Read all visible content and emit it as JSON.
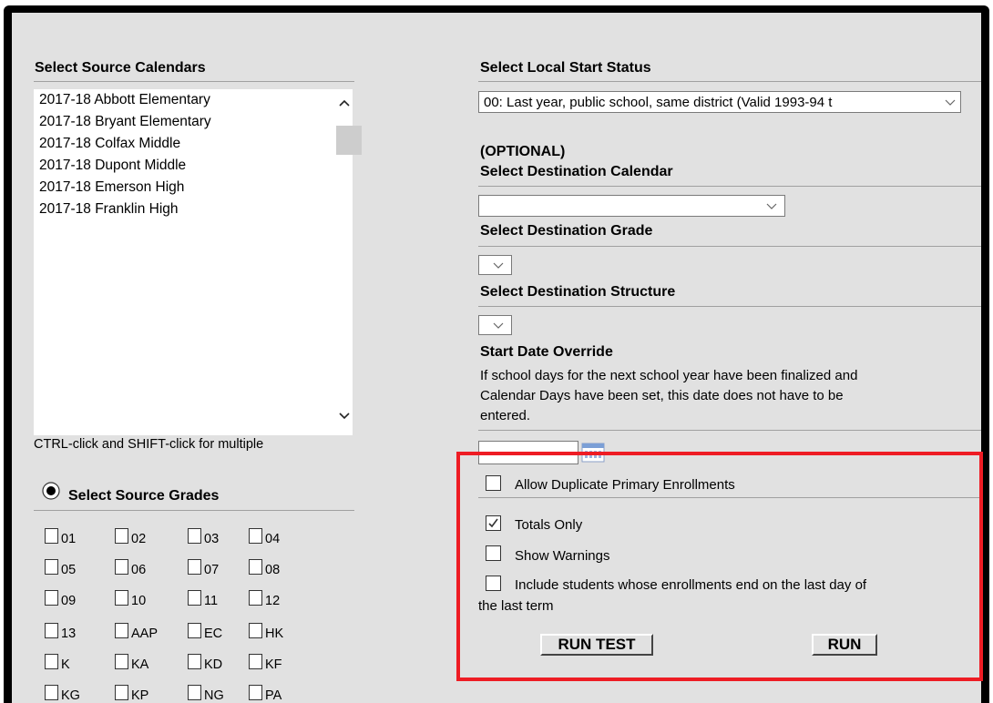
{
  "left": {
    "source_calendars_heading": "Select Source Calendars",
    "calendars": [
      "2017-18 Abbott Elementary",
      "2017-18 Bryant Elementary",
      "2017-18 Colfax Middle",
      "2017-18 Dupont Middle",
      "2017-18 Emerson High",
      "2017-18 Franklin High"
    ],
    "multi_select_hint": "CTRL-click and SHIFT-click for multiple",
    "source_grades_heading": "Select Source Grades",
    "grades": [
      "01",
      "02",
      "03",
      "04",
      "05",
      "06",
      "07",
      "08",
      "09",
      "10",
      "11",
      "12",
      "13",
      "AAP",
      "EC",
      "HK",
      "K",
      "KA",
      "KD",
      "KF",
      "KG",
      "KP",
      "NG",
      "PA"
    ]
  },
  "right": {
    "local_start_status_heading": "Select Local Start Status",
    "local_start_status_value": "00: Last year, public school, same district (Valid 1993-94 t",
    "optional_label": "(OPTIONAL)",
    "destination_calendar_heading": "Select Destination Calendar",
    "destination_grade_heading": "Select Destination Grade",
    "destination_structure_heading": "Select Destination Structure",
    "start_date_override_heading": "Start Date Override",
    "start_date_note_line1": "If school days for the next school year have been finalized and",
    "start_date_note_line2": "Calendar Days have been set, this date does not have to be",
    "start_date_note_line3": "entered.",
    "options": {
      "allow_duplicate": "Allow Duplicate Primary Enrollments",
      "totals_only": "Totals Only",
      "show_warnings": "Show Warnings",
      "include_students_line1": "Include students whose enrollments end on the last day of",
      "include_students_line2": "the last term"
    },
    "run_test_label": "RUN TEST",
    "run_label": "RUN"
  },
  "colors": {
    "highlight": "#ee1c24",
    "panel": "#e1e1e1"
  },
  "state": {
    "totals_only_checked": true,
    "source_grades_radio_selected": true
  }
}
